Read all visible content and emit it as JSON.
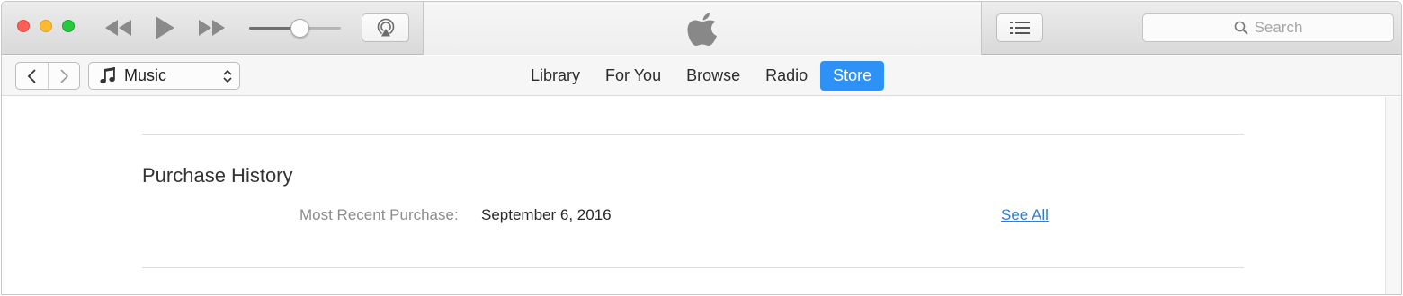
{
  "window": {
    "controls": [
      "close",
      "minimize",
      "zoom"
    ]
  },
  "titlebar": {
    "icons": {
      "rewind": "rewind-icon",
      "play": "play-icon",
      "fast_forward": "fast-forward-icon",
      "airplay": "airplay-icon",
      "apple_logo": "apple-logo",
      "up_next": "list-icon",
      "search": "search-icon"
    },
    "volume_level": 0.55,
    "search_placeholder": "Search"
  },
  "toolbar": {
    "back_icon": "chevron-left-icon",
    "forward_icon": "chevron-right-icon",
    "media_kind": "Music",
    "media_icon": "music-note-icon",
    "tabs": [
      {
        "label": "Library",
        "active": false
      },
      {
        "label": "For You",
        "active": false
      },
      {
        "label": "Browse",
        "active": false
      },
      {
        "label": "Radio",
        "active": false
      },
      {
        "label": "Store",
        "active": true
      }
    ]
  },
  "purchase_history": {
    "title": "Purchase History",
    "most_recent_label": "Most Recent Purchase:",
    "most_recent_date": "September 6, 2016",
    "see_all_link": "See All"
  },
  "colors": {
    "accent": "#2e91f5",
    "link": "#2f7fcf",
    "close": "#fc5f57",
    "minimize": "#fdbc2e",
    "zoom": "#28c940"
  }
}
